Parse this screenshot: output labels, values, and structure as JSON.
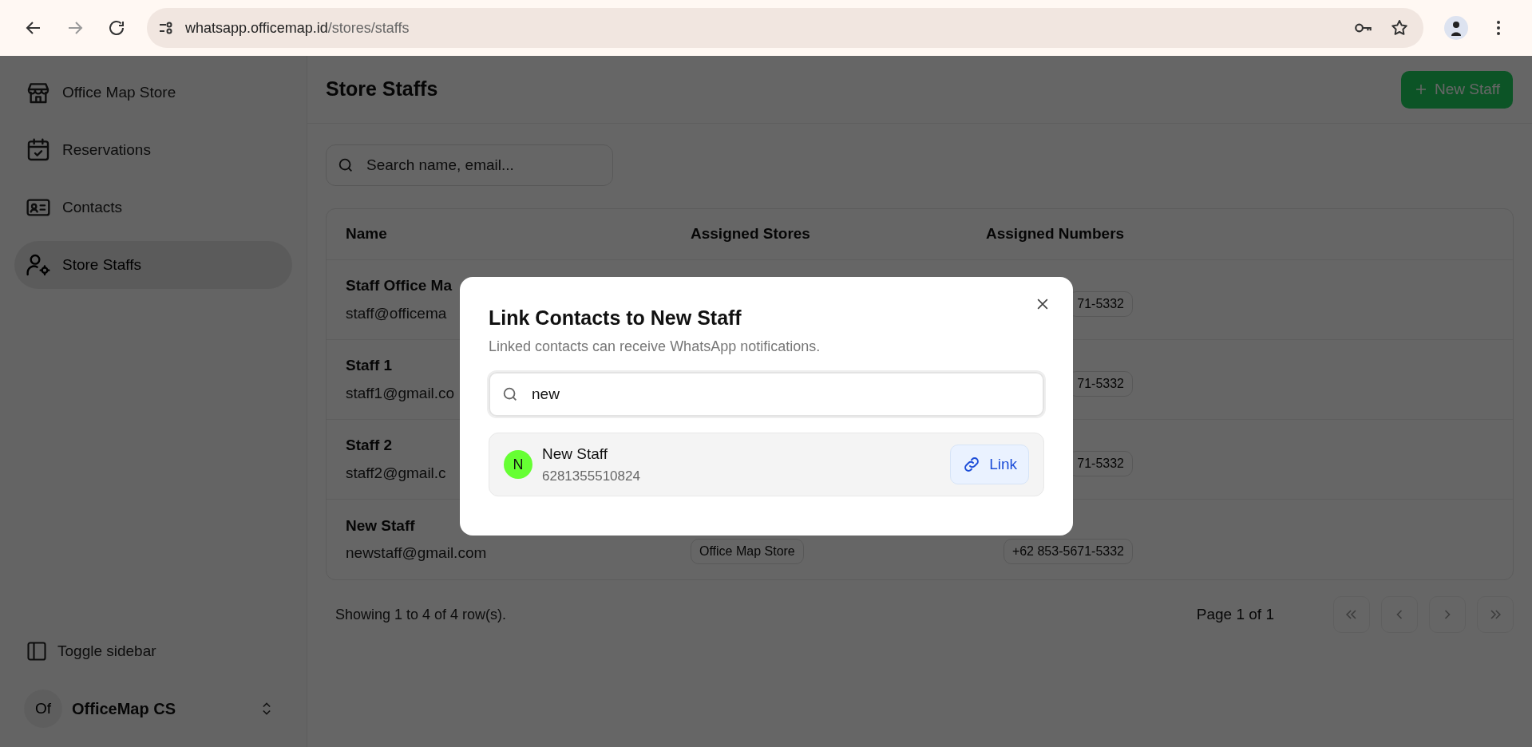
{
  "browser": {
    "url_host": "whatsapp.officemap.id",
    "url_path": "/stores/staffs"
  },
  "sidebar": {
    "items": [
      {
        "label": "Office Map Store",
        "selected": false
      },
      {
        "label": "Reservations",
        "selected": false
      },
      {
        "label": "Contacts",
        "selected": false
      },
      {
        "label": "Store Staffs",
        "selected": true
      }
    ],
    "toggle": "Toggle sidebar",
    "account": {
      "initials": "Of",
      "name": "OfficeMap CS"
    }
  },
  "page": {
    "title": "Store Staffs",
    "new_button": "New Staff",
    "search_placeholder": "Search name, email..."
  },
  "table": {
    "columns": [
      "Name",
      "Assigned Stores",
      "Assigned Numbers"
    ],
    "rows": [
      {
        "name": "Staff Office Ma",
        "email": "staff@officema",
        "numbers": [
          "71-5332"
        ]
      },
      {
        "name": "Staff 1",
        "email": "staff1@gmail.co",
        "numbers": [
          "71-5332"
        ]
      },
      {
        "name": "Staff 2",
        "email": "staff2@gmail.c",
        "numbers": [
          "71-5332"
        ]
      },
      {
        "name": "New Staff",
        "email": "newstaff@gmail.com",
        "stores": [
          "Office Map Store"
        ],
        "numbers": [
          "+62 853-5671-5332"
        ]
      }
    ]
  },
  "footer": {
    "showing": "Showing 1 to 4 of 4 row(s).",
    "page": "Page 1 of 1"
  },
  "dialog": {
    "title": "Link Contacts to New Staff",
    "description": "Linked contacts can receive WhatsApp notifications.",
    "search_value": "new",
    "results": [
      {
        "initial": "N",
        "name": "New Staff",
        "phone": "6281355510824",
        "color": "#66ff33",
        "action": "Link"
      }
    ]
  }
}
